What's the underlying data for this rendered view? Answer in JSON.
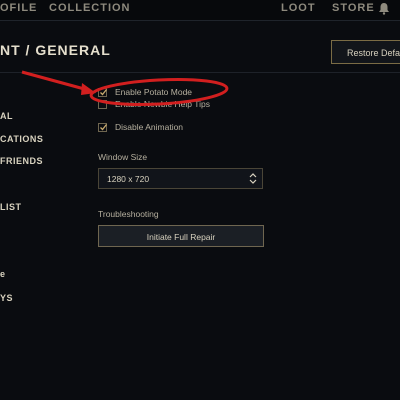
{
  "topnav": {
    "items": [
      "OFILE",
      "COLLECTION",
      "LOOT",
      "STORE"
    ]
  },
  "header": {
    "title": "NT / GENERAL",
    "restore_label": "Restore Defa"
  },
  "sidebar": {
    "items": [
      "AL",
      "CATIONS",
      "FRIENDS",
      "LIST",
      "e",
      "YS"
    ]
  },
  "options": {
    "potato_mode": {
      "label": "Enable Potato Mode",
      "checked": true
    },
    "newbie_tips": {
      "label": "Enable Newbie Help Tips",
      "checked": false
    },
    "disable_animation": {
      "label": "Disable Animation",
      "checked": true
    }
  },
  "window_size": {
    "label": "Window Size",
    "value": "1280 x 720"
  },
  "troubleshooting": {
    "label": "Troubleshooting",
    "button_label": "Initiate Full Repair"
  },
  "colors": {
    "annotation_red": "#d21f1f",
    "gold_accent": "#c8aa6e"
  },
  "icons": {
    "notification": "bell-icon",
    "dropdown": "updown-chevron-icon",
    "check": "checkmark-icon"
  }
}
